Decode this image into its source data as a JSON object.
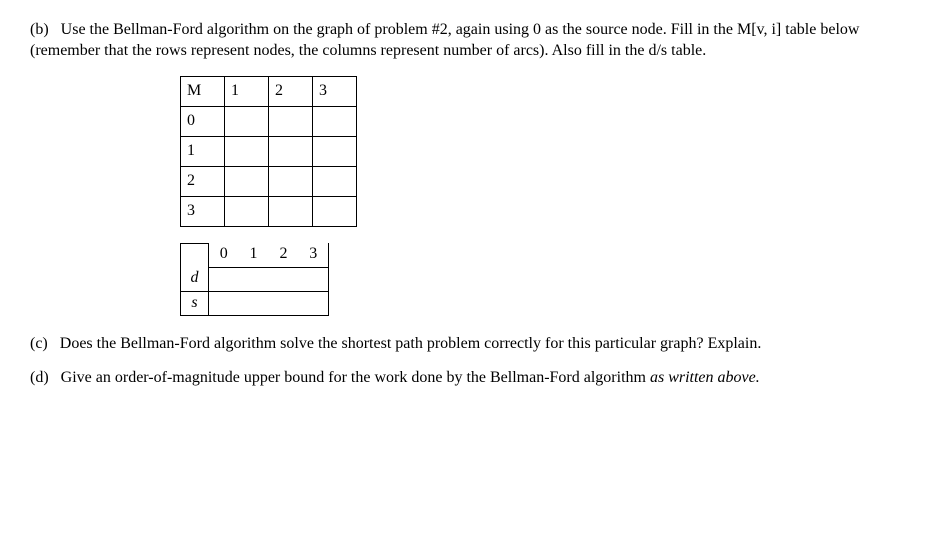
{
  "partB": {
    "label": "(b)",
    "text": "Use the Bellman-Ford algorithm on the graph of problem #2, again using 0 as the source node.  Fill in the M[v, i] table below (remember that the rows represent nodes, the columns represent number of arcs).  Also fill in the d/s table."
  },
  "mTable": {
    "header": [
      "M",
      "1",
      "2",
      "3"
    ],
    "rows": [
      [
        "0",
        "",
        "",
        ""
      ],
      [
        "1",
        "",
        "",
        ""
      ],
      [
        "2",
        "",
        "",
        ""
      ],
      [
        "3",
        "",
        "",
        ""
      ]
    ]
  },
  "dsTable": {
    "columns": [
      "0",
      "1",
      "2",
      "3"
    ],
    "rowLabels": [
      "d",
      "s"
    ]
  },
  "partC": {
    "label": "(c)",
    "text": "Does the Bellman-Ford algorithm solve the shortest path problem correctly for this particular graph?  Explain."
  },
  "partD": {
    "label": "(d)",
    "text_prefix": "Give an order-of-magnitude upper bound for the work done by the Bellman-Ford algorithm ",
    "text_italic": "as written above."
  }
}
